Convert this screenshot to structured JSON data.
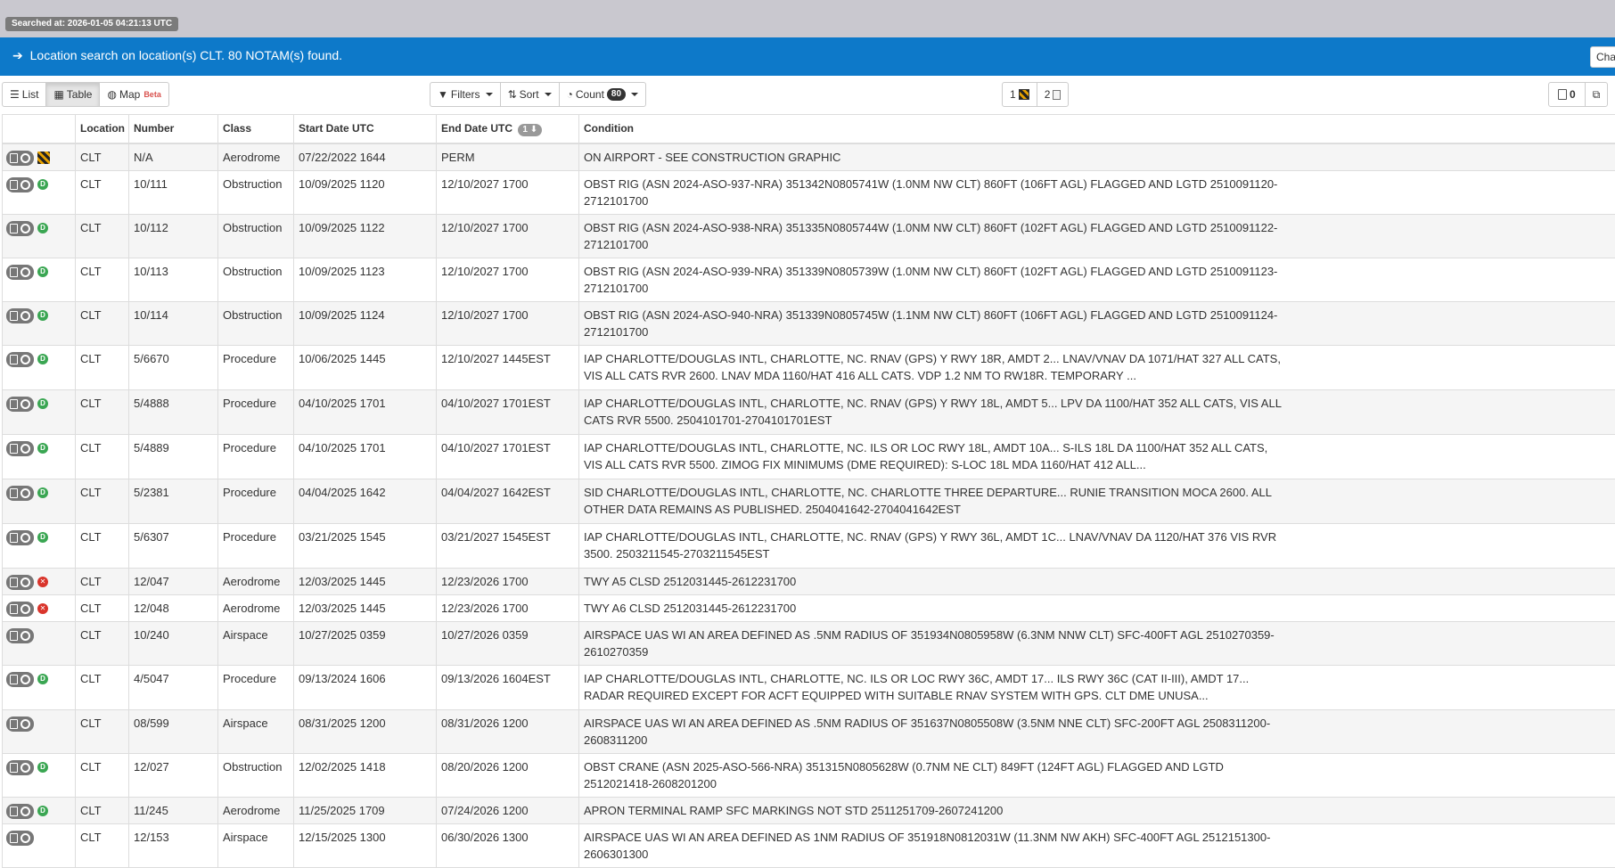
{
  "header": {
    "searched_at": "Searched at: 2026-01-05 04:21:13 UTC"
  },
  "banner": {
    "message": "Location search on location(s) CLT. 80 NOTAM(s) found.",
    "change_button": "Cha"
  },
  "toolbar": {
    "view_tabs": [
      {
        "label": "List",
        "icon": "list-icon",
        "active": false
      },
      {
        "label": "Table",
        "icon": "table-icon",
        "active": true
      },
      {
        "label": "Map",
        "icon": "globe-icon",
        "badge": "Beta",
        "active": false
      }
    ],
    "filters_label": "Filters",
    "sort_label": "Sort",
    "count_label": "Count",
    "count_value": "80",
    "page_buttons": [
      {
        "label": "1",
        "icon": "hazard-icon"
      },
      {
        "label": "2",
        "icon": "document-icon"
      }
    ],
    "pdf_count": "0"
  },
  "table": {
    "columns": [
      "",
      "Location",
      "Number",
      "Class",
      "Start Date UTC",
      "End Date UTC",
      "Condition"
    ],
    "end_date_sort_badge": "1",
    "rows": [
      {
        "status": "hazard",
        "location": "CLT",
        "number": "N/A",
        "class": "Aerodrome",
        "start": "07/22/2022 1644",
        "end": "PERM",
        "condition": "ON AIRPORT - SEE CONSTRUCTION GRAPHIC"
      },
      {
        "status": "green",
        "location": "CLT",
        "number": "10/111",
        "class": "Obstruction",
        "start": "10/09/2025 1120",
        "end": "12/10/2027 1700",
        "condition": "OBST RIG (ASN 2024-ASO-937-NRA) 351342N0805741W (1.0NM NW CLT) 860FT (106FT AGL) FLAGGED AND LGTD 2510091120-2712101700"
      },
      {
        "status": "green",
        "location": "CLT",
        "number": "10/112",
        "class": "Obstruction",
        "start": "10/09/2025 1122",
        "end": "12/10/2027 1700",
        "condition": "OBST RIG (ASN 2024-ASO-938-NRA) 351335N0805744W (1.0NM NW CLT) 860FT (102FT AGL) FLAGGED AND LGTD 2510091122-2712101700"
      },
      {
        "status": "green",
        "location": "CLT",
        "number": "10/113",
        "class": "Obstruction",
        "start": "10/09/2025 1123",
        "end": "12/10/2027 1700",
        "condition": "OBST RIG (ASN 2024-ASO-939-NRA) 351339N0805739W (1.0NM NW CLT) 860FT (102FT AGL) FLAGGED AND LGTD 2510091123-2712101700"
      },
      {
        "status": "green",
        "location": "CLT",
        "number": "10/114",
        "class": "Obstruction",
        "start": "10/09/2025 1124",
        "end": "12/10/2027 1700",
        "condition": "OBST RIG (ASN 2024-ASO-940-NRA) 351339N0805745W (1.1NM NW CLT) 860FT (106FT AGL) FLAGGED AND LGTD 2510091124-2712101700"
      },
      {
        "status": "green",
        "location": "CLT",
        "number": "5/6670",
        "class": "Procedure",
        "start": "10/06/2025 1445",
        "end": "12/10/2027 1445EST",
        "condition": "IAP CHARLOTTE/DOUGLAS INTL, CHARLOTTE, NC. RNAV (GPS) Y RWY 18R, AMDT 2... LNAV/VNAV DA 1071/HAT 327 ALL CATS, VIS ALL CATS RVR 2600. LNAV MDA 1160/HAT 416 ALL CATS. VDP 1.2 NM TO RW18R. TEMPORARY ..."
      },
      {
        "status": "green",
        "location": "CLT",
        "number": "5/4888",
        "class": "Procedure",
        "start": "04/10/2025 1701",
        "end": "04/10/2027 1701EST",
        "condition": "IAP CHARLOTTE/DOUGLAS INTL, CHARLOTTE, NC. RNAV (GPS) Y RWY 18L, AMDT 5... LPV DA 1100/HAT 352 ALL CATS, VIS ALL CATS RVR 5500. 2504101701-2704101701EST"
      },
      {
        "status": "green",
        "location": "CLT",
        "number": "5/4889",
        "class": "Procedure",
        "start": "04/10/2025 1701",
        "end": "04/10/2027 1701EST",
        "condition": "IAP CHARLOTTE/DOUGLAS INTL, CHARLOTTE, NC. ILS OR LOC RWY 18L, AMDT 10A... S-ILS 18L DA 1100/HAT 352 ALL CATS, VIS ALL CATS RVR 5500. ZIMOG FIX MINIMUMS (DME REQUIRED): S-LOC 18L MDA 1160/HAT 412 ALL..."
      },
      {
        "status": "green",
        "location": "CLT",
        "number": "5/2381",
        "class": "Procedure",
        "start": "04/04/2025 1642",
        "end": "04/04/2027 1642EST",
        "condition": "SID CHARLOTTE/DOUGLAS INTL, CHARLOTTE, NC. CHARLOTTE THREE DEPARTURE... RUNIE TRANSITION MOCA 2600. ALL OTHER DATA REMAINS AS PUBLISHED. 2504041642-2704041642EST"
      },
      {
        "status": "green",
        "location": "CLT",
        "number": "5/6307",
        "class": "Procedure",
        "start": "03/21/2025 1545",
        "end": "03/21/2027 1545EST",
        "condition": "IAP CHARLOTTE/DOUGLAS INTL, CHARLOTTE, NC. RNAV (GPS) Y RWY 36L, AMDT 1C... LNAV/VNAV DA 1120/HAT 376 VIS RVR 3500. 2503211545-2703211545EST"
      },
      {
        "status": "red",
        "location": "CLT",
        "number": "12/047",
        "class": "Aerodrome",
        "start": "12/03/2025 1445",
        "end": "12/23/2026 1700",
        "condition": "TWY A5 CLSD 2512031445-2612231700"
      },
      {
        "status": "red",
        "location": "CLT",
        "number": "12/048",
        "class": "Aerodrome",
        "start": "12/03/2025 1445",
        "end": "12/23/2026 1700",
        "condition": "TWY A6 CLSD 2512031445-2612231700"
      },
      {
        "status": "none",
        "location": "CLT",
        "number": "10/240",
        "class": "Airspace",
        "start": "10/27/2025 0359",
        "end": "10/27/2026 0359",
        "condition": "AIRSPACE UAS WI AN AREA DEFINED AS .5NM RADIUS OF 351934N0805958W (6.3NM NNW CLT) SFC-400FT AGL 2510270359-2610270359"
      },
      {
        "status": "green",
        "location": "CLT",
        "number": "4/5047",
        "class": "Procedure",
        "start": "09/13/2024 1606",
        "end": "09/13/2026 1604EST",
        "condition": "IAP CHARLOTTE/DOUGLAS INTL, CHARLOTTE, NC. ILS OR LOC RWY 36C, AMDT 17... ILS RWY 36C (CAT II-III), AMDT 17... RADAR REQUIRED EXCEPT FOR ACFT EQUIPPED WITH SUITABLE RNAV SYSTEM WITH GPS. CLT DME UNUSA..."
      },
      {
        "status": "none",
        "location": "CLT",
        "number": "08/599",
        "class": "Airspace",
        "start": "08/31/2025 1200",
        "end": "08/31/2026 1200",
        "condition": "AIRSPACE UAS WI AN AREA DEFINED AS .5NM RADIUS OF 351637N0805508W (3.5NM NNE CLT) SFC-200FT AGL 2508311200-2608311200"
      },
      {
        "status": "green",
        "location": "CLT",
        "number": "12/027",
        "class": "Obstruction",
        "start": "12/02/2025 1418",
        "end": "08/20/2026 1200",
        "condition": "OBST CRANE (ASN 2025-ASO-566-NRA) 351315N0805628W (0.7NM NE CLT) 849FT (124FT AGL) FLAGGED AND LGTD 2512021418-2608201200"
      },
      {
        "status": "green",
        "location": "CLT",
        "number": "11/245",
        "class": "Aerodrome",
        "start": "11/25/2025 1709",
        "end": "07/24/2026 1200",
        "condition": "APRON TERMINAL RAMP SFC MARKINGS NOT STD 2511251709-2607241200"
      },
      {
        "status": "none",
        "location": "CLT",
        "number": "12/153",
        "class": "Airspace",
        "start": "12/15/2025 1300",
        "end": "06/30/2026 1300",
        "condition": "AIRSPACE UAS WI AN AREA DEFINED AS 1NM RADIUS OF 351918N0812031W (11.3NM NW AKH) SFC-400FT AGL 2512151300-2606301300"
      }
    ]
  },
  "colors": {
    "banner": "#0d79c9",
    "status_green": "#3aa652",
    "status_red": "#d9342b",
    "topbar": "#c9c8cf"
  }
}
